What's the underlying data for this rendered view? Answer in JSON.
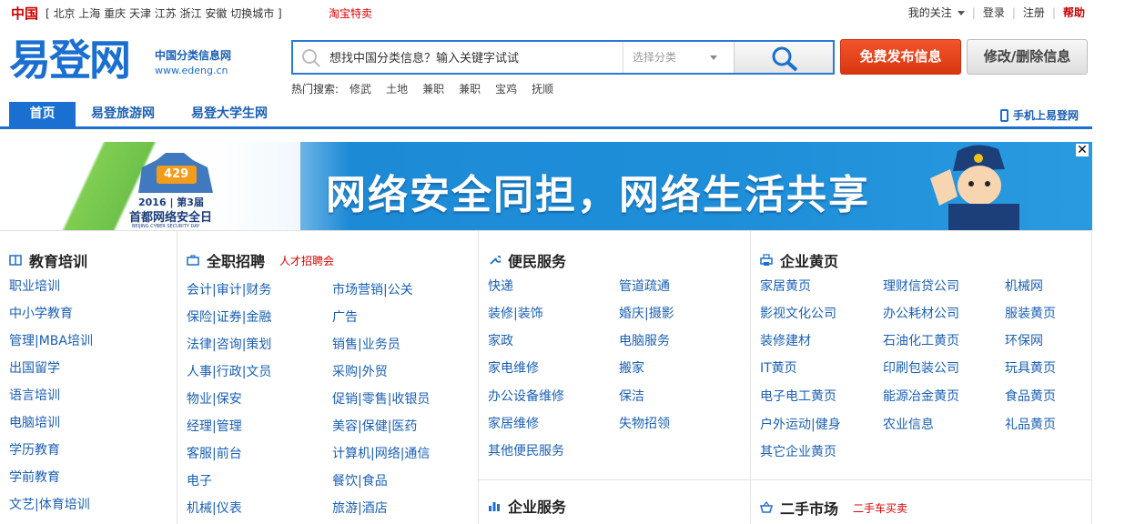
{
  "topbar": {
    "country": "中国",
    "cities": "[ 北京 上海 重庆 天津 江苏 浙江 安徽 切换城市 ]",
    "taobao": "淘宝特卖",
    "follow": "我的关注",
    "login": "登录",
    "register": "注册",
    "help": "帮助"
  },
  "header": {
    "logo_text": "易登网",
    "slogan": "中国分类信息网",
    "domain": "www.edeng.cn",
    "search_placeholder": "想找中国分类信息？输入关键字试试",
    "category_placeholder": "选择分类",
    "publish_button": "免费发布信息",
    "edit_button": "修改/删除信息",
    "hot_label": "热门搜索:",
    "hot_keywords": [
      "修武",
      "土地",
      "兼职",
      "兼职",
      "宝鸡",
      "抚顺"
    ]
  },
  "nav": {
    "tabs": [
      "首页",
      "易登旅游网",
      "易登大学生网"
    ],
    "mobile": "手机上易登网"
  },
  "banner": {
    "slogan": "网络安全同担，网络生活共享",
    "emblem_badge": "429",
    "emblem_year": "2016 | 第3届",
    "emblem_name": "首都网络安全日",
    "emblem_en": "BEIJING CYBER SECURITY DAY",
    "close": "✕"
  },
  "sections": {
    "education": {
      "title": "教育培训",
      "links": [
        "职业培训",
        "中小学教育",
        "管理|MBA培训",
        "出国留学",
        "语言培训",
        "电脑培训",
        "学历教育",
        "学前教育",
        "文艺|体育培训"
      ]
    },
    "jobs": {
      "title": "全职招聘",
      "sub": "人才招聘会",
      "left": [
        "会计|审计|财务",
        "保险|证券|金融",
        "法律|咨询|策划",
        "人事|行政|文员",
        "物业|保安",
        "经理|管理",
        "客服|前台",
        "电子",
        "机械|仪表"
      ],
      "right": [
        "市场营销|公关",
        "广告",
        "销售|业务员",
        "采购|外贸",
        "促销|零售|收银员",
        "美容|保健|医药",
        "计算机|网络|通信",
        "餐饮|食品",
        "旅游|酒店"
      ]
    },
    "services": {
      "title": "便民服务",
      "left": [
        "快递",
        "装修|装饰",
        "家政",
        "家电维修",
        "办公设备维修",
        "家居维修",
        "其他便民服务"
      ],
      "right": [
        "管道疏通",
        "婚庆|摄影",
        "电脑服务",
        "搬家",
        "保洁",
        "失物招领"
      ]
    },
    "business": {
      "title": "企业服务"
    },
    "yellow": {
      "title": "企业黄页",
      "col1": [
        "家居黄页",
        "影视文化公司",
        "装修建材",
        "IT黄页",
        "电子电工黄页",
        "户外运动|健身",
        "其它企业黄页"
      ],
      "col2": [
        "理财信贷公司",
        "办公耗材公司",
        "石油化工黄页",
        "印刷包装公司",
        "能源冶金黄页",
        "农业信息"
      ],
      "col3": [
        "机械网",
        "服装黄页",
        "环保网",
        "玩具黄页",
        "食品黄页",
        "礼品黄页"
      ]
    },
    "secondhand": {
      "title": "二手市场",
      "sub": "二手车买卖"
    }
  },
  "colors": {
    "brand_blue": "#1a6fd0",
    "publish_red": "#e2421a",
    "link_blue": "#1a5fb4",
    "accent_red": "#dd0000"
  }
}
